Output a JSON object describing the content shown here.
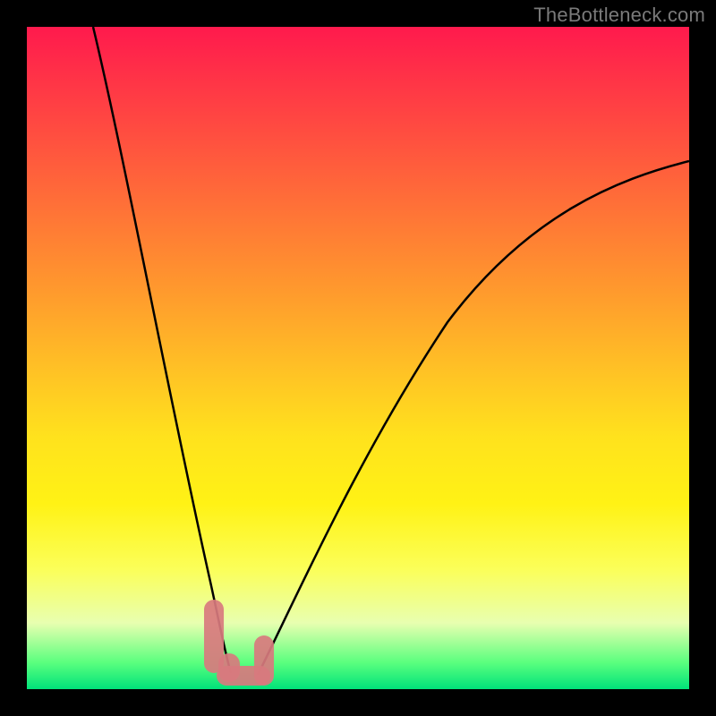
{
  "watermark": "TheBottleneck.com",
  "colors": {
    "frame": "#000000",
    "gradient_top": "#ff1a4d",
    "gradient_mid": "#ffe21d",
    "gradient_bottom": "#00e27a",
    "curve": "#000000",
    "blob": "#d87a7e"
  },
  "chart_data": {
    "type": "line",
    "title": "",
    "xlabel": "",
    "ylabel": "",
    "xlim": [
      0,
      100
    ],
    "ylim": [
      0,
      100
    ],
    "series": [
      {
        "name": "left-curve",
        "x": [
          10,
          12,
          14,
          16,
          18,
          20,
          22,
          24,
          26,
          27.5,
          29,
          30
        ],
        "y": [
          100,
          88,
          76,
          64,
          52,
          40,
          29,
          19,
          10,
          5,
          2.5,
          2
        ]
      },
      {
        "name": "right-curve",
        "x": [
          35,
          38,
          42,
          47,
          53,
          60,
          68,
          77,
          87,
          100
        ],
        "y": [
          2,
          7,
          15,
          25,
          36,
          47,
          57,
          66,
          74,
          80
        ]
      }
    ],
    "annotations": [
      {
        "name": "highlight-blob",
        "shape": "v-segment",
        "approx_x_range": [
          27,
          36
        ],
        "approx_y_range": [
          0,
          11
        ]
      }
    ]
  }
}
